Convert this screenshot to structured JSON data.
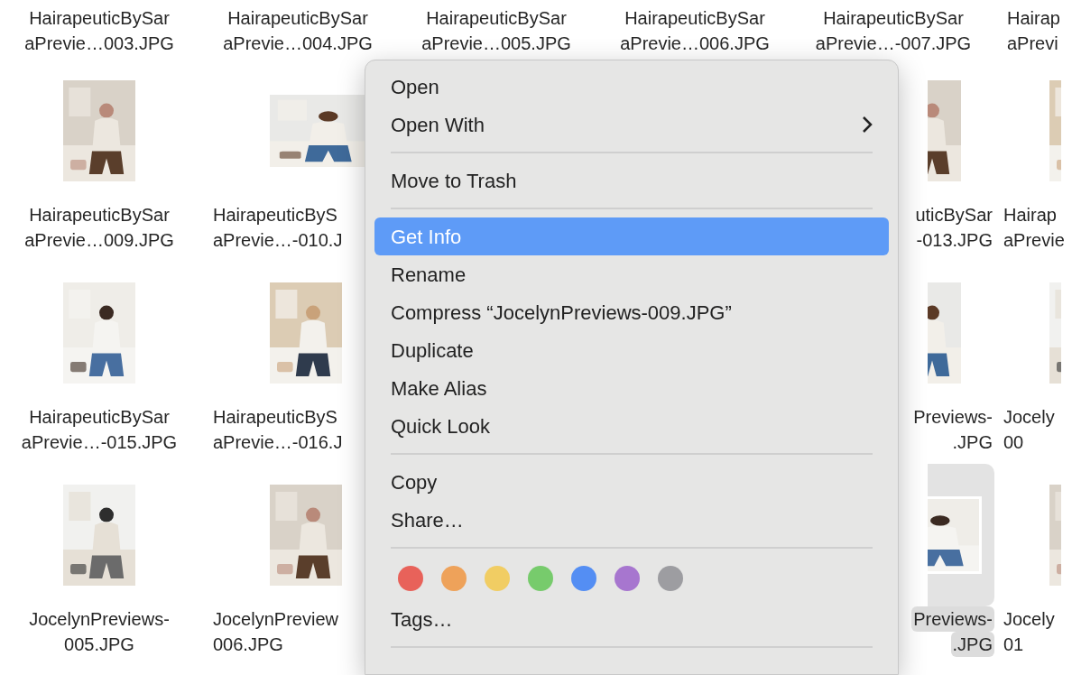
{
  "top_row": [
    {
      "lines": [
        "HairapeuticBySar",
        "aPrevie…003.JPG"
      ],
      "selected": false
    },
    {
      "lines": [
        "HairapeuticBySar",
        "aPrevie…004.JPG"
      ],
      "selected": false
    },
    {
      "lines": [
        "HairapeuticBySar",
        "aPrevie…005.JPG"
      ],
      "selected": false
    },
    {
      "lines": [
        "HairapeuticBySar",
        "aPrevie…006.JPG"
      ],
      "selected": false
    },
    {
      "lines": [
        "HairapeuticBySar",
        "aPrevie…-007.JPG"
      ],
      "selected": false
    },
    {
      "lines": [
        "Hairap",
        "aPrevi"
      ],
      "selected": false
    }
  ],
  "rows": [
    {
      "cells": [
        {
          "lines": [
            "HairapeuticBySar",
            "aPrevie…009.JPG"
          ],
          "selected": false
        },
        {
          "lines": [
            "HairapeuticByS",
            "aPrevie…-010.J"
          ],
          "selected": false
        },
        {
          "lines": [
            "uticBySar",
            "-013.JPG"
          ],
          "selected": false
        },
        {
          "lines": [
            "Hairap",
            "aPrevie"
          ],
          "selected": false
        }
      ]
    },
    {
      "cells": [
        {
          "lines": [
            "HairapeuticBySar",
            "aPrevie…-015.JPG"
          ],
          "selected": false
        },
        {
          "lines": [
            "HairapeuticByS",
            "aPrevie…-016.J"
          ],
          "selected": false
        },
        {
          "lines": [
            "Previews-",
            ".JPG"
          ],
          "selected": false
        },
        {
          "lines": [
            "Jocely",
            "00"
          ],
          "selected": false
        }
      ]
    },
    {
      "cells": [
        {
          "lines": [
            "JocelynPreviews-",
            "005.JPG"
          ],
          "selected": false
        },
        {
          "lines": [
            "JocelynPreview",
            "006.JPG"
          ],
          "selected": false
        },
        {
          "lines": [
            "Previews-",
            ".JPG"
          ],
          "selected": true
        },
        {
          "lines": [
            "Jocely",
            "01"
          ],
          "selected": false
        }
      ]
    }
  ],
  "context_menu": {
    "items": [
      {
        "kind": "item",
        "label": "Open",
        "selected": false,
        "submenu": false
      },
      {
        "kind": "item",
        "label": "Open With",
        "selected": false,
        "submenu": true
      },
      {
        "kind": "separator"
      },
      {
        "kind": "item",
        "label": "Move to Trash",
        "selected": false,
        "submenu": false
      },
      {
        "kind": "separator"
      },
      {
        "kind": "item",
        "label": "Get Info",
        "selected": true,
        "submenu": false
      },
      {
        "kind": "item",
        "label": "Rename",
        "selected": false,
        "submenu": false
      },
      {
        "kind": "item",
        "label": "Compress “JocelynPreviews-009.JPG”",
        "selected": false,
        "submenu": false
      },
      {
        "kind": "item",
        "label": "Duplicate",
        "selected": false,
        "submenu": false
      },
      {
        "kind": "item",
        "label": "Make Alias",
        "selected": false,
        "submenu": false
      },
      {
        "kind": "item",
        "label": "Quick Look",
        "selected": false,
        "submenu": false
      },
      {
        "kind": "separator"
      },
      {
        "kind": "item",
        "label": "Copy",
        "selected": false,
        "submenu": false
      },
      {
        "kind": "item",
        "label": "Share…",
        "selected": false,
        "submenu": false
      },
      {
        "kind": "separator"
      },
      {
        "kind": "tags",
        "tags": [
          {
            "color": "#e8625a"
          },
          {
            "color": "#eea25a"
          },
          {
            "color": "#f1cd63"
          },
          {
            "color": "#77cb6c"
          },
          {
            "color": "#548ef3"
          },
          {
            "color": "#a776cf"
          },
          {
            "color": "#9d9da1"
          }
        ]
      },
      {
        "kind": "item",
        "label": "Tags…",
        "selected": false,
        "submenu": false
      },
      {
        "kind": "separator"
      }
    ]
  }
}
